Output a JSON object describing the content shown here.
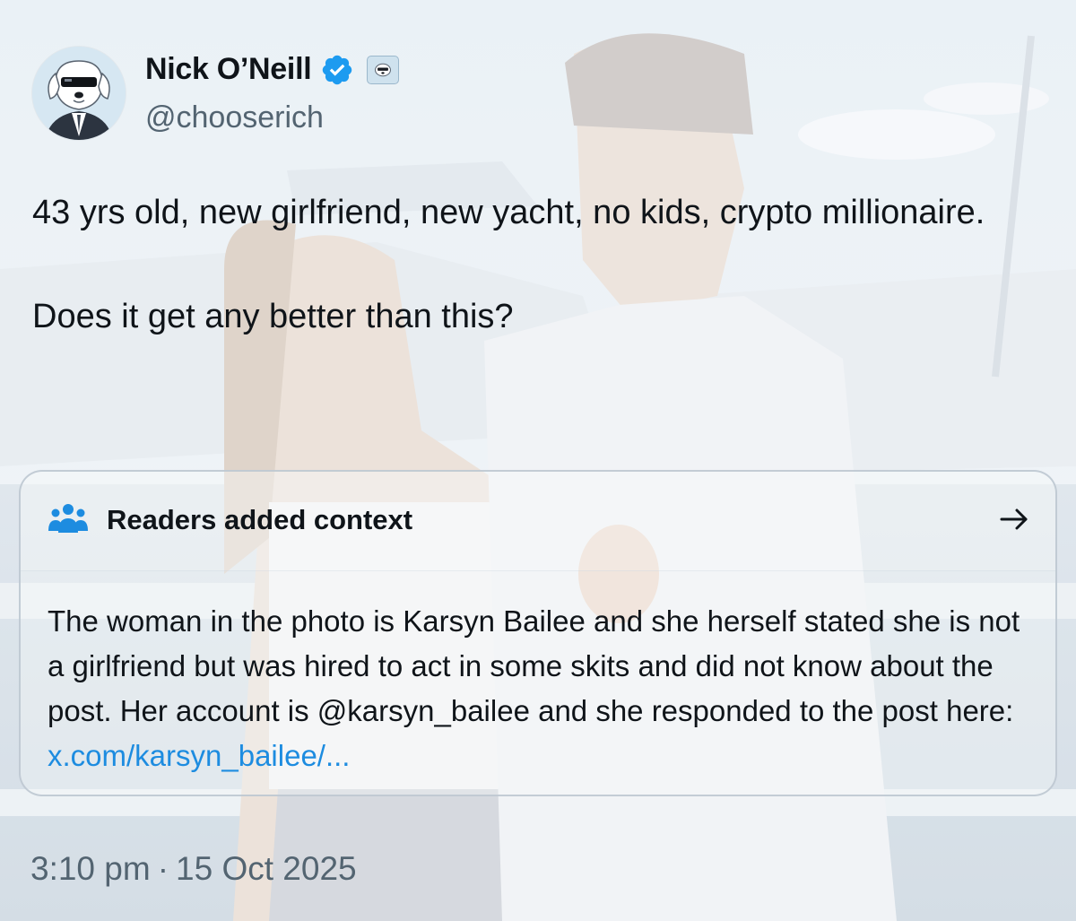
{
  "author": {
    "display_name": "Nick O’Neill",
    "handle": "@chooserich",
    "avatar_icon": "cartoon-dog-sunglasses-avatar",
    "verified_icon": "verified-badge-icon",
    "affiliate_icon": "affiliate-badge-icon"
  },
  "tweet": {
    "line_1": "43 yrs old, new girlfriend, new yacht, no kids, crypto millionaire.",
    "line_2": "Does it get any better than this?"
  },
  "community_note": {
    "icon": "people-group-icon",
    "title": "Readers added context",
    "arrow_icon": "arrow-right-icon",
    "body": "The woman in the photo is Karsyn Bailee and she herself stated she is not a girlfriend but was hired to act in some skits and did not know about the post. Her account is  @karsyn_bailee and she responded to the post here: ",
    "link_text": "x.com/karsyn_bailee/..."
  },
  "timestamp": {
    "time": "3:10 pm",
    "separator": "·",
    "date": "15 Oct 2025"
  },
  "colors": {
    "link": "#1d8ce0",
    "verified": "#1d9bf0",
    "secondary_text": "#536471",
    "primary_text": "#0f1419"
  }
}
